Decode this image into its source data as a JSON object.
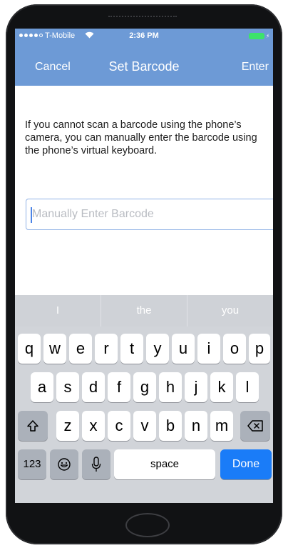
{
  "status_bar": {
    "carrier": "T-Mobile",
    "time": "2:36 PM"
  },
  "nav": {
    "cancel_label": "Cancel",
    "title": "Set Barcode",
    "enter_label": "Enter"
  },
  "content": {
    "instructions": "If you cannot scan a barcode using the phone’s camera, you can manually enter the barcode using the phone’s virtual keyboard.",
    "barcode_placeholder": "Manually Enter Barcode",
    "barcode_value": ""
  },
  "keyboard": {
    "suggestions": [
      "I",
      "the",
      "you"
    ],
    "row1": [
      "q",
      "w",
      "e",
      "r",
      "t",
      "y",
      "u",
      "i",
      "o",
      "p"
    ],
    "row2": [
      "a",
      "s",
      "d",
      "f",
      "g",
      "h",
      "j",
      "k",
      "l"
    ],
    "row3": [
      "z",
      "x",
      "c",
      "v",
      "b",
      "n",
      "m"
    ],
    "numbers_label": "123",
    "space_label": "space",
    "done_label": "Done"
  },
  "colors": {
    "nav_background": "#6d9ad6",
    "done_key": "#1a7cf8",
    "input_border": "#92b3e6"
  }
}
